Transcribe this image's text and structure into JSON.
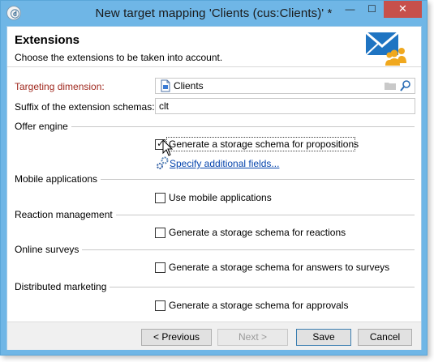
{
  "window": {
    "title": "New target mapping 'Clients (cus:Clients)' *",
    "min_glyph": "—",
    "max_glyph": "☐",
    "close_glyph": "✕",
    "app_icon_glyph": "ⓓ"
  },
  "header": {
    "title": "Extensions",
    "subtitle": "Choose the extensions to be taken into account."
  },
  "form": {
    "targeting_label": "Targeting dimension:",
    "targeting_value": "Clients",
    "suffix_label": "Suffix of the extension schemas:",
    "suffix_value": "clt"
  },
  "sections": {
    "offer": {
      "title": "Offer engine",
      "checkbox_label": "Generate a storage schema for propositions",
      "checked": true,
      "link": "Specify additional fields..."
    },
    "mobile": {
      "title": "Mobile applications",
      "checkbox_label": "Use mobile applications",
      "checked": false
    },
    "reaction": {
      "title": "Reaction management",
      "checkbox_label": "Generate a storage schema for reactions",
      "checked": false
    },
    "surveys": {
      "title": "Online surveys",
      "checkbox_label": "Generate a storage schema for answers to surveys",
      "checked": false
    },
    "distributed": {
      "title": "Distributed marketing",
      "checkbox_label": "Generate a storage schema for approvals",
      "checked": false
    }
  },
  "footer": {
    "previous": "< Previous",
    "next": "Next >",
    "save": "Save",
    "cancel": "Cancel"
  },
  "icons": {
    "header": "envelope-users-icon",
    "targeting": "schema-file-icon",
    "folder": "folder-icon",
    "search": "magnifier-icon",
    "link": "gears-icon"
  },
  "colors": {
    "titlebar": "#6fb6e6",
    "close_button": "#c7504b",
    "required_label": "#a0291f",
    "link": "#0645ad"
  }
}
